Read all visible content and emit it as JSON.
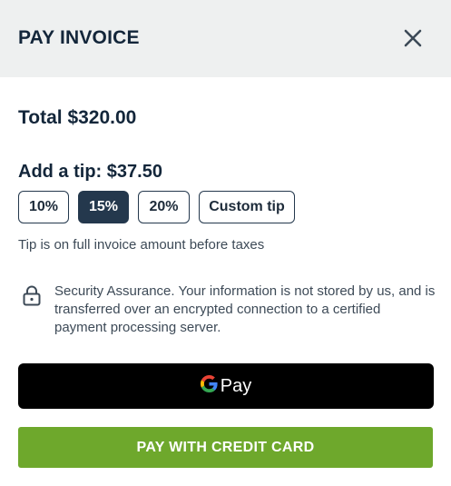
{
  "header": {
    "title": "PAY INVOICE",
    "close_icon": "close-icon"
  },
  "total": {
    "label": "Total $320.00"
  },
  "tip": {
    "heading": "Add a tip: $37.50",
    "options": [
      "10%",
      "15%",
      "20%",
      "Custom tip"
    ],
    "selected": "15%",
    "note": "Tip is on full invoice amount before taxes"
  },
  "security": {
    "icon": "lock-icon",
    "text": "Security Assurance. Your information is not stored by us, and is transferred over an encrypted connection to a certified payment processing server."
  },
  "gpay": {
    "label": "Pay",
    "icon": "google-g-icon"
  },
  "credit_card": {
    "label": "PAY WITH CREDIT CARD"
  },
  "colors": {
    "header_bg": "#eef0f0",
    "dark_navy": "#24384d",
    "gpay_bg": "#000000",
    "credit_card_green": "#6ea82c"
  }
}
